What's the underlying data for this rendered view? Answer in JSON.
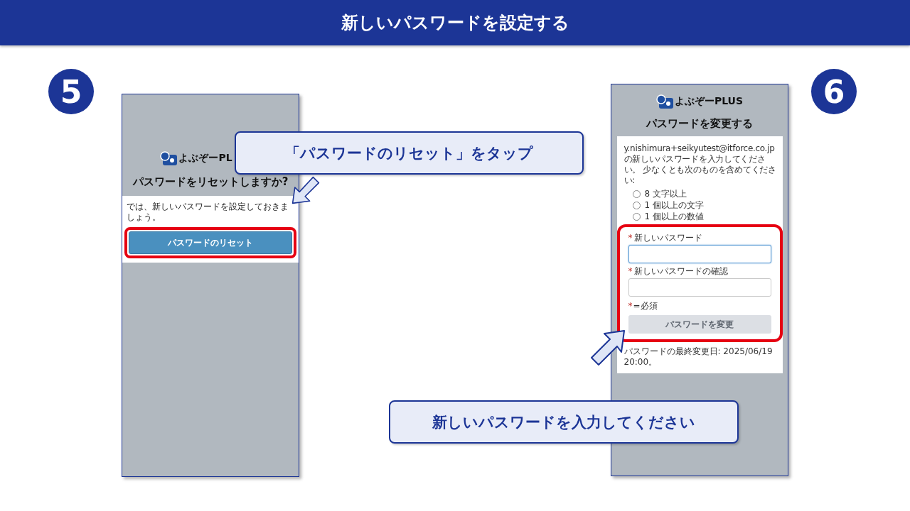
{
  "header": {
    "title": "新しいパスワードを設定する"
  },
  "reset_screen": {
    "step": "5",
    "brand": "よぶぞーPL",
    "title": "パスワードをリセットしますか?",
    "message": "では、新しいパスワードを設定しておきましょう。",
    "button": "パスワードのリセット"
  },
  "change_screen": {
    "step": "6",
    "brand": "よぶぞーPLUS",
    "title": "パスワードを変更する",
    "intro": "y.nishimura+seikyutest@itforce.co.jp の新しいパスワードを入力してください。 少なくとも次のものを含めてください:",
    "requirements": [
      {
        "label": "8 文字以上",
        "checked": false
      },
      {
        "label": "1 個以上の文字",
        "checked": false
      },
      {
        "label": "1 個以上の数値",
        "checked": false
      }
    ],
    "fields": [
      {
        "mark": "*",
        "label": "新しいパスワード",
        "focused": true
      },
      {
        "mark": "*",
        "label": "新しいパスワードの確認",
        "focused": false
      }
    ],
    "legend": {
      "mark": "*",
      "text": "=必須"
    },
    "button": {
      "label": "パスワードを変更",
      "disabled": true
    },
    "last_changed": "パスワードの最終変更日: 2025/06/19 20:00。"
  },
  "callouts": [
    {
      "text": "「パスワードのリセット」をタップ"
    },
    {
      "text": "新しいパスワードを入力してください"
    }
  ]
}
